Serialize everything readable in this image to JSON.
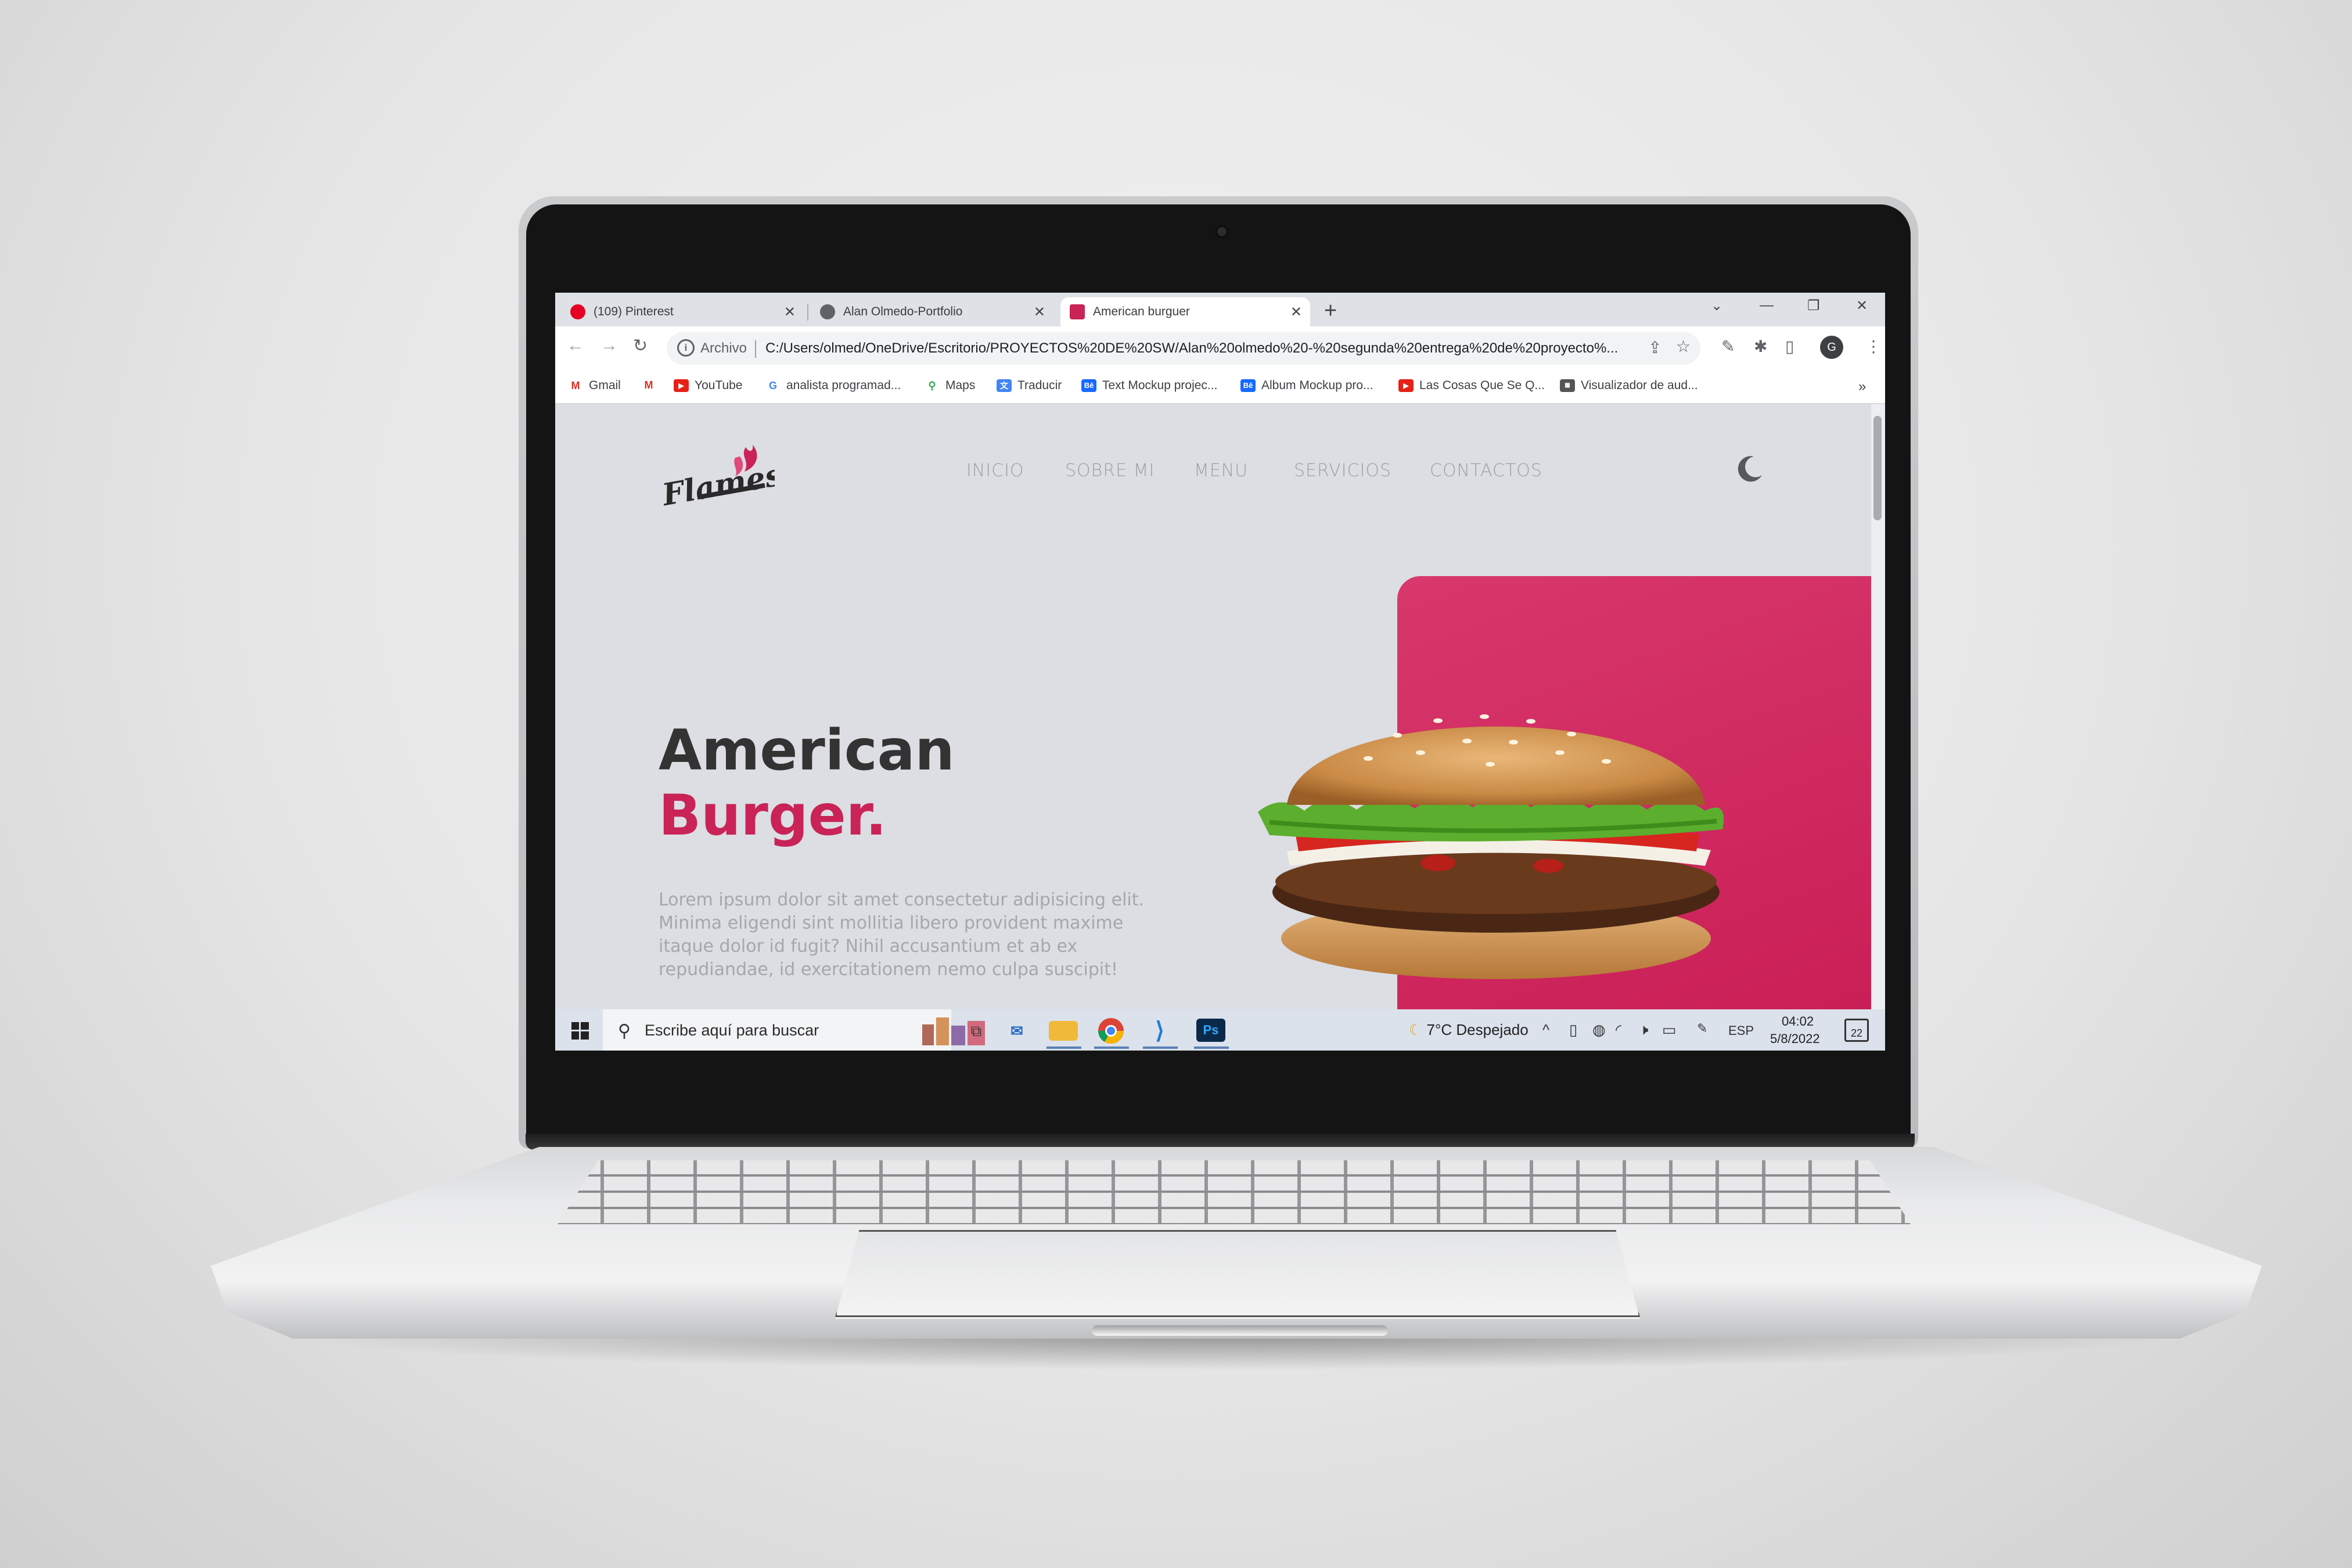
{
  "browser": {
    "tabs": [
      {
        "label": "(109) Pinterest",
        "favicon": "pinterest-icon"
      },
      {
        "label": "Alan Olmedo-Portfolio",
        "favicon": "globe-icon"
      },
      {
        "label": "American burguer",
        "favicon": "flames-icon",
        "active": true
      }
    ],
    "new_tab": "+",
    "window_controls": {
      "chevron": "⌄",
      "minimize": "—",
      "restore": "❐",
      "close": "✕"
    },
    "address": {
      "security_label": "Archivo",
      "url": "C:/Users/olmed/OneDrive/Escritorio/PROYECTOS%20DE%20SW/Alan%20olmedo%20-%20segunda%20entrega%20de%20proyecto%..."
    },
    "bookmarks": [
      {
        "label": "Gmail",
        "icon": "gmail-icon"
      },
      {
        "label": "",
        "icon": "gmail-icon"
      },
      {
        "label": "YouTube",
        "icon": "youtube-icon"
      },
      {
        "label": "analista programad...",
        "icon": "google-icon"
      },
      {
        "label": "Maps",
        "icon": "maps-icon"
      },
      {
        "label": "Traducir",
        "icon": "translate-icon"
      },
      {
        "label": "Text Mockup projec...",
        "icon": "behance-icon"
      },
      {
        "label": "Album Mockup pro...",
        "icon": "behance-icon"
      },
      {
        "label": "Las Cosas Que Se Q...",
        "icon": "youtube-icon"
      },
      {
        "label": "Visualizador de aud...",
        "icon": "site-icon"
      }
    ],
    "bookmarks_overflow": "»"
  },
  "page": {
    "logo_text": "Flames",
    "nav": [
      "INICIO",
      "SOBRE MI",
      "MENU",
      "SERVICIOS",
      "CONTACTOS"
    ],
    "hero_title_line1": "American",
    "hero_title_line2": "Burger.",
    "hero_description": "Lorem ipsum dolor sit amet consectetur adipisicing elit. Minima eligendi sint mollitia libero provident maxime itaque dolor id fugit? Nihil accusantium et ab ex repudiandae, id exercitationem nemo culpa suscipit!",
    "accent_color": "#c92357"
  },
  "taskbar": {
    "search_placeholder": "Escribe aquí para buscar",
    "apps": [
      "task-view-icon",
      "mail-icon",
      "file-explorer-icon",
      "chrome-icon",
      "vscode-icon",
      "photoshop-icon"
    ],
    "weather": "7°C  Despejado",
    "language": "ESP",
    "time": "04:02",
    "date": "5/8/2022",
    "notifications": "22"
  }
}
